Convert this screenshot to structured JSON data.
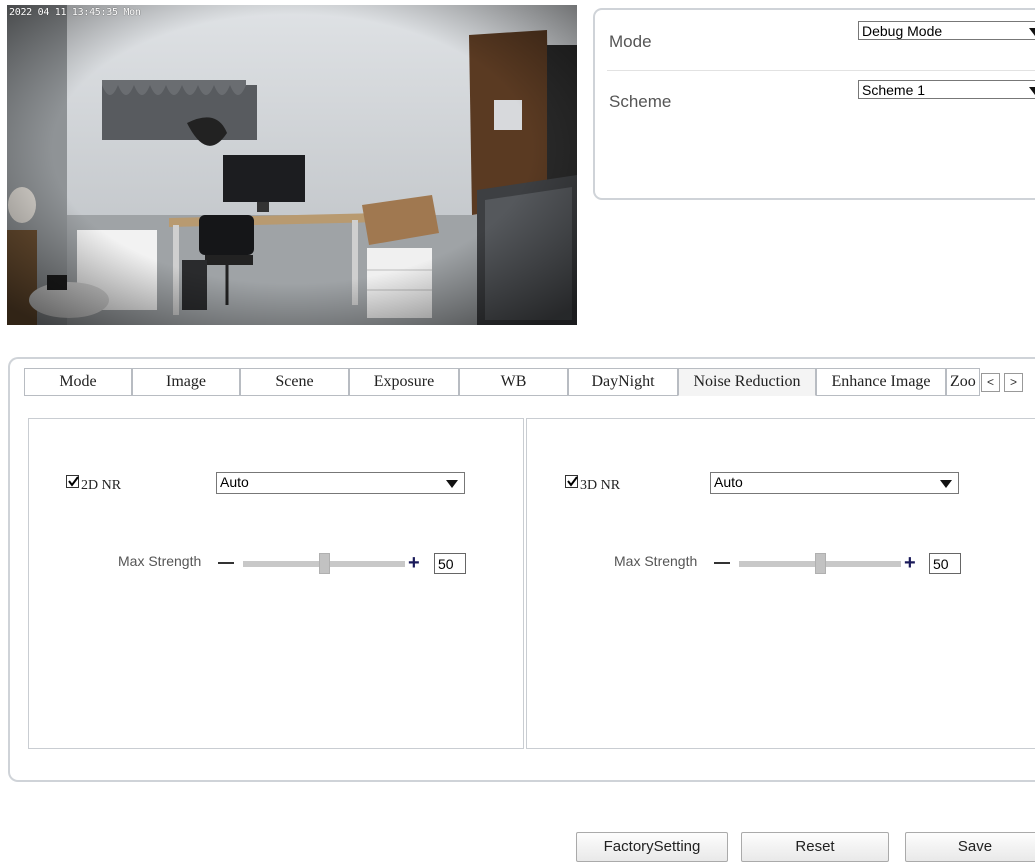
{
  "preview": {
    "osd_text": "2022 04 11 13:45:35 Mon"
  },
  "settings": {
    "mode_label": "Mode",
    "mode_value": "Debug Mode",
    "scheme_label": "Scheme",
    "scheme_value": "Scheme 1"
  },
  "tabs": [
    {
      "label": "Mode"
    },
    {
      "label": "Image"
    },
    {
      "label": "Scene"
    },
    {
      "label": "Exposure"
    },
    {
      "label": "WB"
    },
    {
      "label": "DayNight"
    },
    {
      "label": "Noise Reduction",
      "active": true
    },
    {
      "label": "Enhance Image"
    },
    {
      "label": "Zoo"
    }
  ],
  "tab_nav": {
    "prev": "<",
    "next": ">"
  },
  "nr2d": {
    "enabled": true,
    "label": "2D NR",
    "mode": "Auto",
    "strength_label": "Max Strength",
    "strength_value": "50",
    "strength_fraction": 0.5
  },
  "nr3d": {
    "enabled": true,
    "label": "3D NR",
    "mode": "Auto",
    "strength_label": "Max Strength",
    "strength_value": "50",
    "strength_fraction": 0.5
  },
  "buttons": {
    "factory": "FactorySetting",
    "reset": "Reset",
    "save": "Save"
  }
}
